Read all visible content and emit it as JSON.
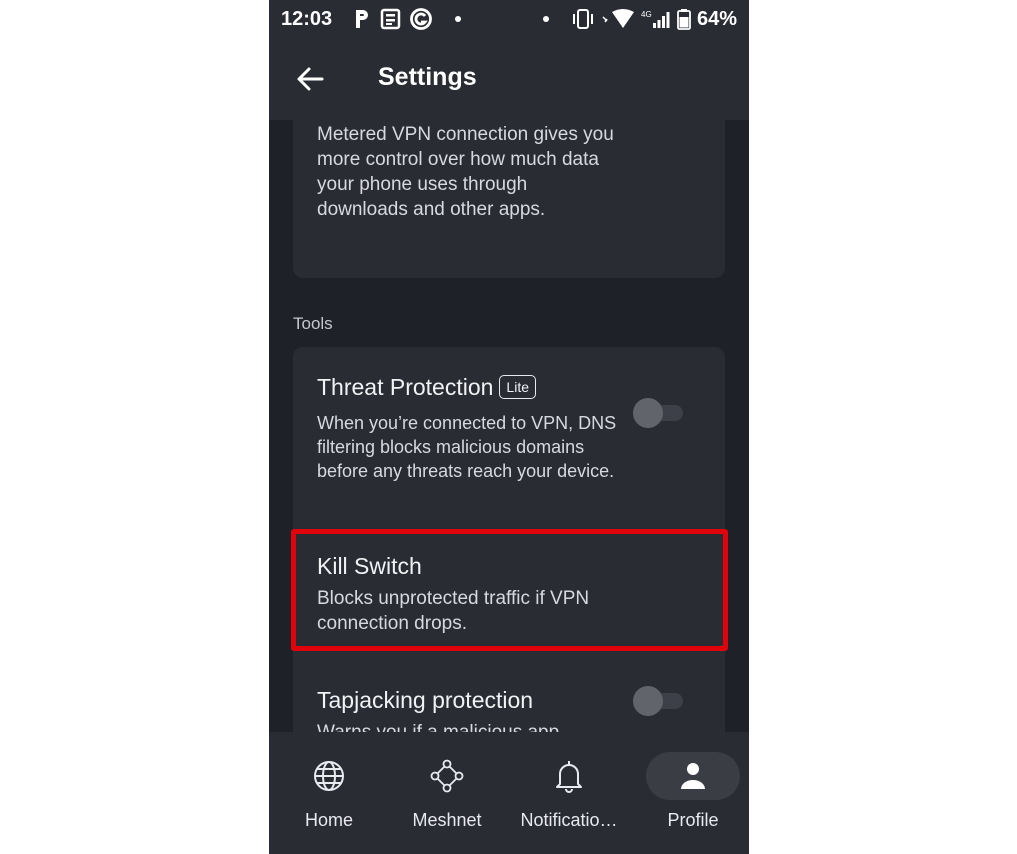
{
  "status_bar": {
    "time": "12:03",
    "battery": "64%",
    "network": "4G",
    "icons": [
      "parking-icon",
      "news-icon",
      "grammarly-icon",
      "dot-icon",
      "dot-icon",
      "vibrate-icon",
      "wifi-icon",
      "signal-icon",
      "battery-icon"
    ]
  },
  "header": {
    "title": "Settings",
    "back_icon": "arrow-left-icon"
  },
  "metered_card": {
    "description": "Metered VPN connection gives you more control over how much data your phone uses through downloads and other apps."
  },
  "tools_section": {
    "label": "Tools",
    "items": [
      {
        "title": "Threat Protection",
        "badge": "Lite",
        "description": "When you’re connected to VPN, DNS filtering blocks malicious domains before any threats reach your device.",
        "toggle_on": false
      },
      {
        "title": "Kill Switch",
        "description": "Blocks unprotected traffic if VPN connection drops."
      },
      {
        "title": "Tapjacking protection",
        "description": "Warns you if a malicious app",
        "toggle_on": false
      }
    ]
  },
  "bottom_nav": {
    "items": [
      {
        "label": "Home",
        "icon": "globe-icon",
        "active": false
      },
      {
        "label": "Meshnet",
        "icon": "meshnet-icon",
        "active": false
      },
      {
        "label": "Notificatio…",
        "icon": "bell-icon",
        "active": false
      },
      {
        "label": "Profile",
        "icon": "person-icon",
        "active": true
      }
    ]
  },
  "colors": {
    "background": "#1f2128",
    "surface": "#2a2c33",
    "highlight": "#e0030c",
    "text": "#e8eaee"
  }
}
